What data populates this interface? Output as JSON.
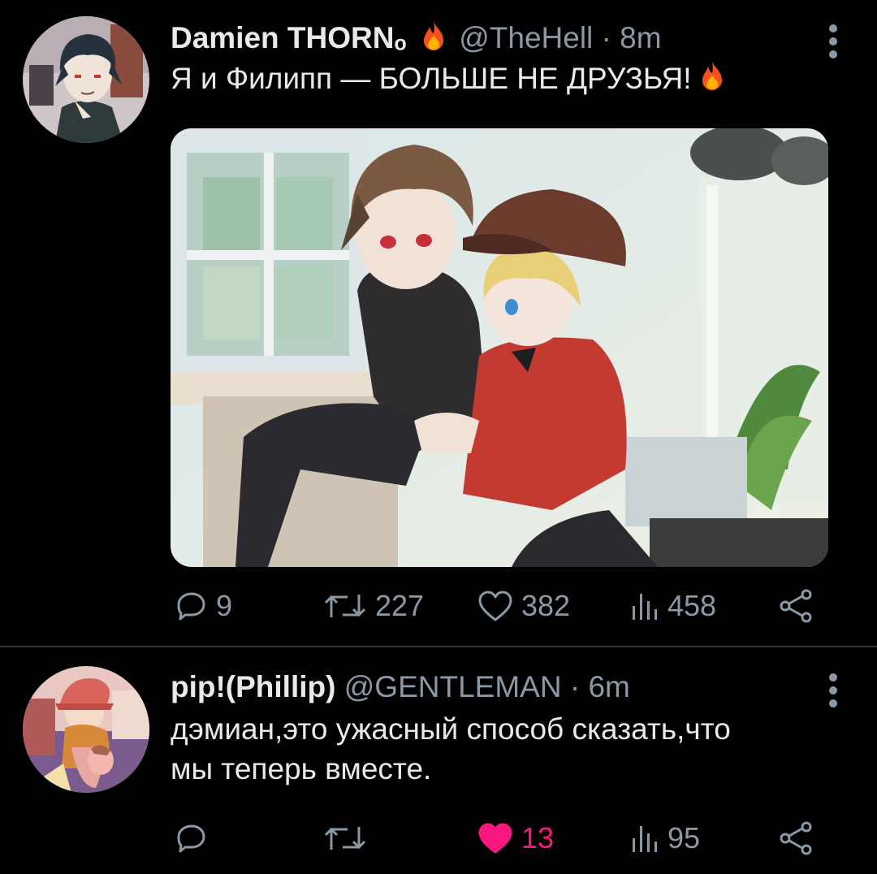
{
  "tweets": [
    {
      "author": {
        "name": "Damien THORNₒ",
        "handle": "@TheHell",
        "time": "8m",
        "badge_icon": "fire-icon"
      },
      "text": "Я и Филипп — БОЛЬШЕ НЕ ДРУЗЬЯ!",
      "text_icon": "fire-icon",
      "has_media": true,
      "stats": {
        "replies": "9",
        "retweets": "227",
        "likes": "382",
        "views": "458"
      },
      "liked": false
    },
    {
      "author": {
        "name": "pip!(Phillip)",
        "handle": "@GENTLEMAN",
        "time": "6m"
      },
      "text_lines": [
        "дэмиан,это ужасный способ сказать,что",
        "мы теперь вместе."
      ],
      "has_media": false,
      "stats": {
        "replies": "",
        "retweets": "",
        "likes": "13",
        "views": "95"
      },
      "liked": true
    }
  ],
  "colors": {
    "background": "#000000",
    "text": "#e7e9ea",
    "secondary": "#8b98a5",
    "like": "#f91880",
    "divider": "#2f3336"
  },
  "icons": [
    "reply-icon",
    "retweet-icon",
    "like-icon",
    "views-icon",
    "share-icon",
    "more-icon",
    "fire-icon"
  ]
}
